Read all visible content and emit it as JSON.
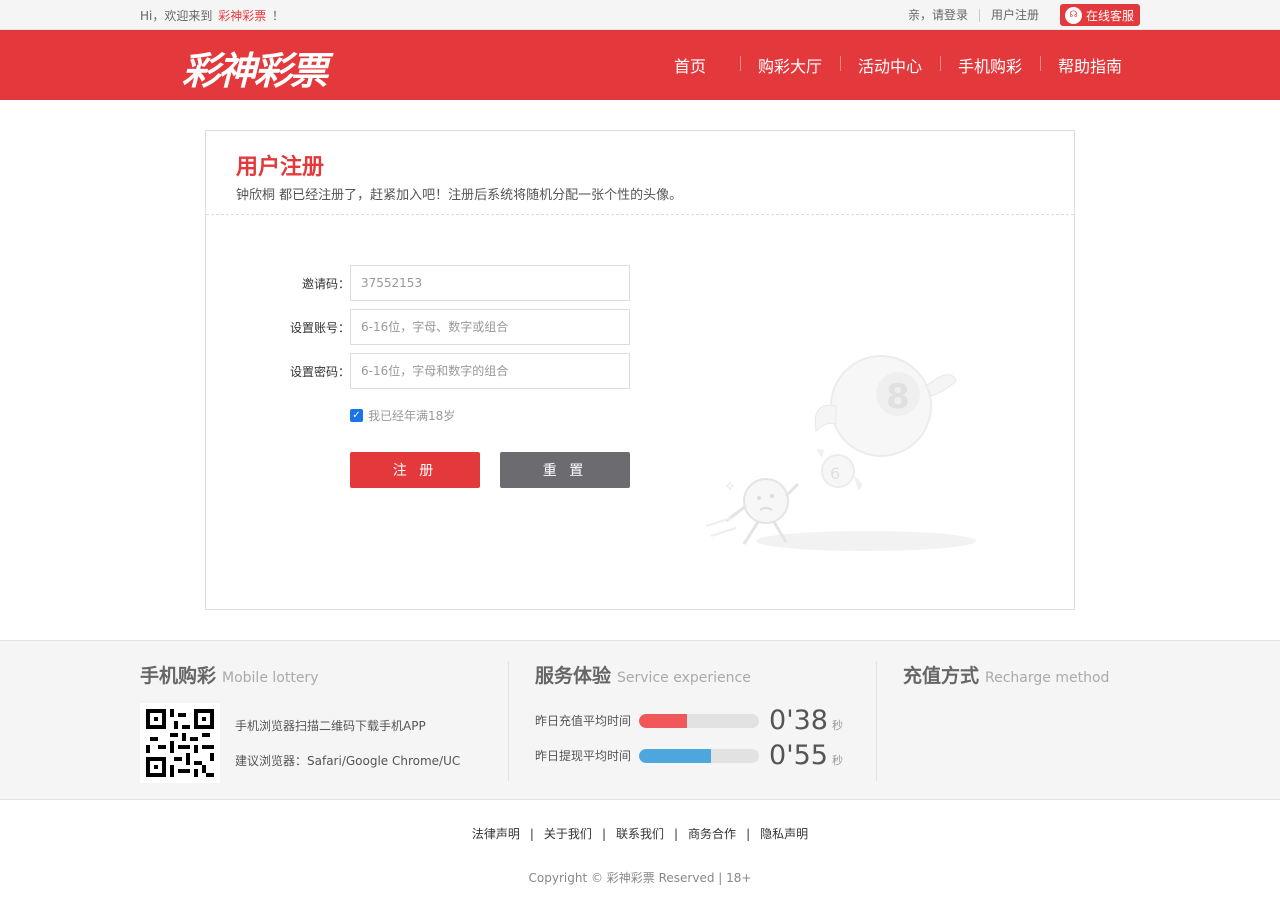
{
  "topbar": {
    "greeting": "Hi，欢迎来到",
    "brand": "彩神彩票",
    "exclaim": "！",
    "login": "亲，请登录",
    "register": "用户注册",
    "service": "在线客服"
  },
  "header": {
    "logo": "彩神彩票",
    "nav": [
      "首页",
      "购彩大厅",
      "活动中心",
      "手机购彩",
      "帮助指南"
    ]
  },
  "register": {
    "title": "用户注册",
    "subtitle": "钟欣桐 都已经注册了，赶紧加入吧！注册后系统将随机分配一张个性的头像。",
    "invite_label": "邀请码：",
    "invite_value": "37552153",
    "account_label": "设置账号：",
    "account_placeholder": "6-16位，字母、数字或组合",
    "password_label": "设置密码：",
    "password_placeholder": "6-16位，字母和数字的组合",
    "agree_text": "我已经年满18岁",
    "agree_checked": true,
    "submit_label": "注 册",
    "reset_label": "重 置"
  },
  "footer_info": {
    "mobile": {
      "title": "手机购彩",
      "title_en": "Mobile lottery",
      "line1": "手机浏览器扫描二维码下载手机APP",
      "line2": "建议浏览器：Safari/Google Chrome/UC"
    },
    "service": {
      "title": "服务体验",
      "title_en": "Service experience",
      "stats": [
        {
          "label": "昨日充值平均时间",
          "value": "0'38",
          "unit": "秒",
          "fill": 0.4,
          "color": "#f0585a"
        },
        {
          "label": "昨日提现平均时间",
          "value": "0'55",
          "unit": "秒",
          "fill": 0.6,
          "color": "#4da6dc"
        }
      ]
    },
    "recharge": {
      "title": "充值方式",
      "title_en": "Recharge method"
    }
  },
  "links": [
    "法律声明",
    "关于我们",
    "联系我们",
    "商务合作",
    "隐私声明"
  ],
  "copyright": "Copyright © 彩神彩票 Reserved | 18+"
}
